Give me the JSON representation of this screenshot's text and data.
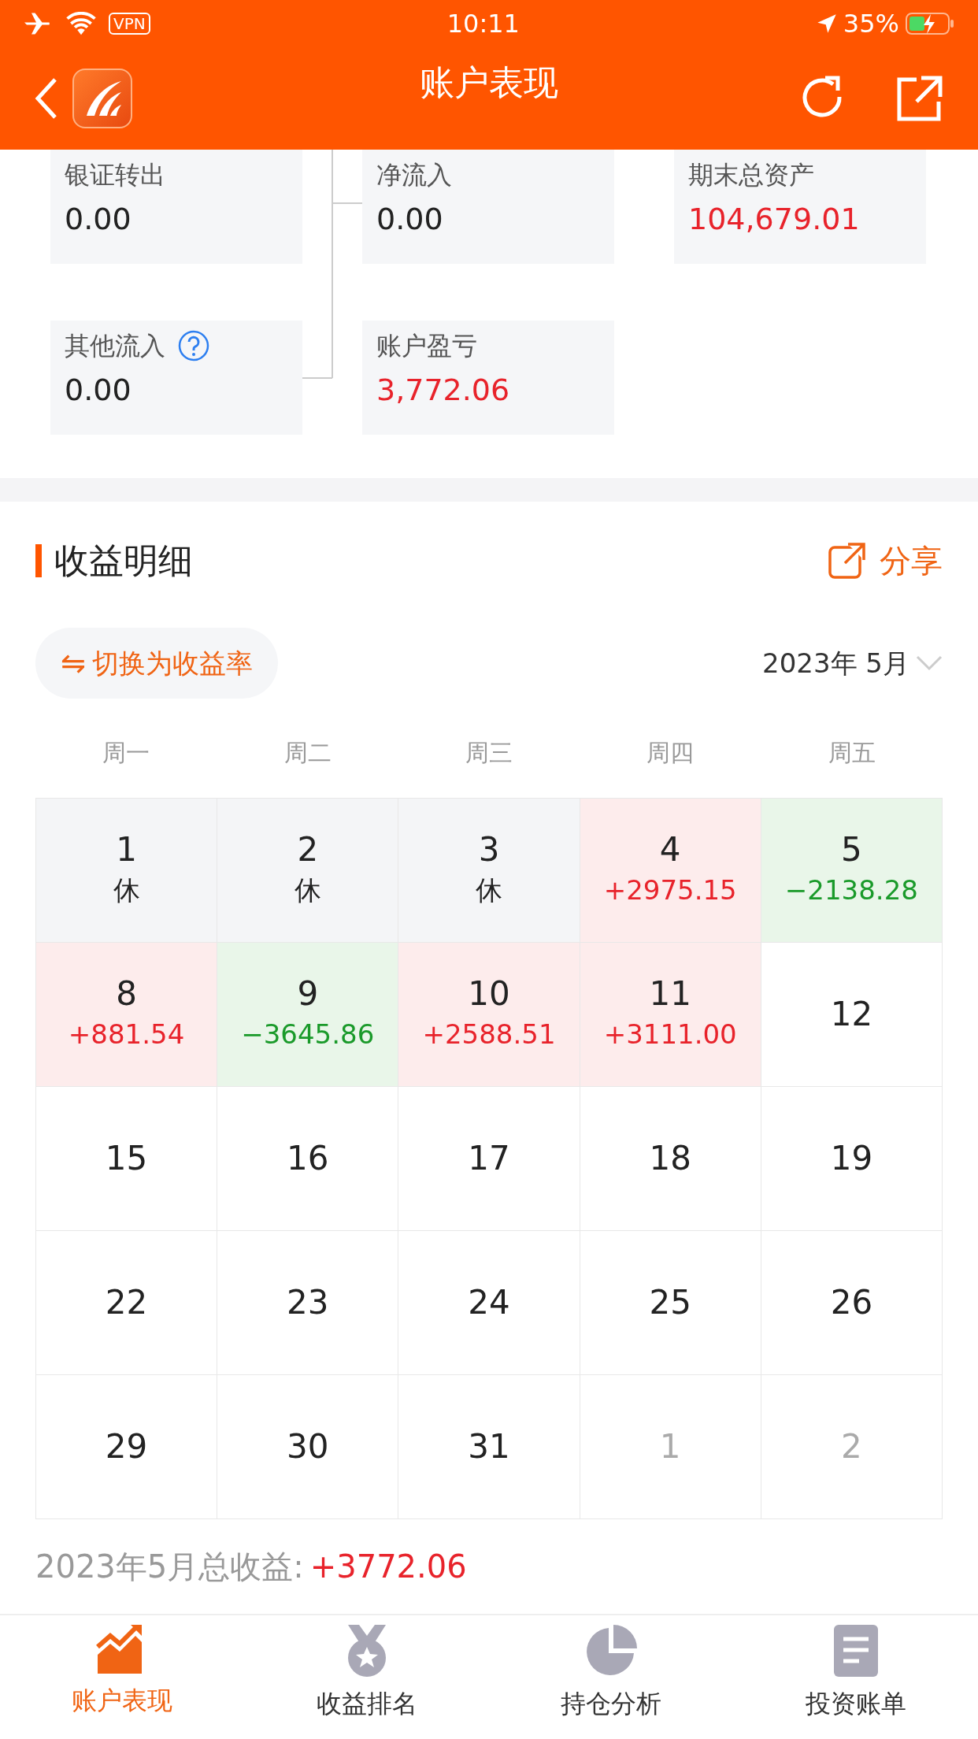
{
  "status_bar": {
    "time": "10:11",
    "vpn": "VPN",
    "battery": "35%"
  },
  "header": {
    "title": "账户表现"
  },
  "flow": [
    [
      {
        "label": "银证转出",
        "value": "0.00",
        "kind": "neutral",
        "help": false
      },
      {
        "label": "净流入",
        "value": "0.00",
        "kind": "neutral",
        "help": false
      },
      {
        "label": "期末总资产",
        "value": "104,679.01",
        "kind": "gain",
        "help": false
      }
    ],
    [
      {
        "label": "其他流入",
        "value": "0.00",
        "kind": "neutral",
        "help": true
      },
      {
        "label": "账户盈亏",
        "value": "3,772.06",
        "kind": "gain",
        "help": false
      }
    ]
  ],
  "section": {
    "title": "收益明细",
    "share": "分享",
    "toggle_icon": "⇋",
    "toggle": "切换为收益率",
    "month": "2023年 5月"
  },
  "weekdays": [
    "周一",
    "周二",
    "周三",
    "周四",
    "周五"
  ],
  "days": [
    {
      "day": "1",
      "note": "休",
      "kind": "rest"
    },
    {
      "day": "2",
      "note": "休",
      "kind": "rest"
    },
    {
      "day": "3",
      "note": "休",
      "kind": "rest"
    },
    {
      "day": "4",
      "note": "+2975.15",
      "kind": "gain"
    },
    {
      "day": "5",
      "note": "−2138.28",
      "kind": "loss"
    },
    {
      "day": "8",
      "note": "+881.54",
      "kind": "gain"
    },
    {
      "day": "9",
      "note": "−3645.86",
      "kind": "loss"
    },
    {
      "day": "10",
      "note": "+2588.51",
      "kind": "gain"
    },
    {
      "day": "11",
      "note": "+3111.00",
      "kind": "gain"
    },
    {
      "day": "12",
      "kind": "none"
    },
    {
      "day": "15",
      "kind": "none"
    },
    {
      "day": "16",
      "kind": "none"
    },
    {
      "day": "17",
      "kind": "none"
    },
    {
      "day": "18",
      "kind": "none"
    },
    {
      "day": "19",
      "kind": "none"
    },
    {
      "day": "22",
      "kind": "none"
    },
    {
      "day": "23",
      "kind": "none"
    },
    {
      "day": "24",
      "kind": "none"
    },
    {
      "day": "25",
      "kind": "none"
    },
    {
      "day": "26",
      "kind": "none"
    },
    {
      "day": "29",
      "kind": "none"
    },
    {
      "day": "30",
      "kind": "none"
    },
    {
      "day": "31",
      "kind": "none"
    },
    {
      "day": "1",
      "kind": "other"
    },
    {
      "day": "2",
      "kind": "other"
    }
  ],
  "total": {
    "label": "2023年5月总收益:",
    "value": "+3772.06"
  },
  "tabs": [
    {
      "label": "账户表现",
      "selected": true
    },
    {
      "label": "收益排名",
      "selected": false
    },
    {
      "label": "持仓分析",
      "selected": false
    },
    {
      "label": "投资账单",
      "selected": false
    }
  ]
}
